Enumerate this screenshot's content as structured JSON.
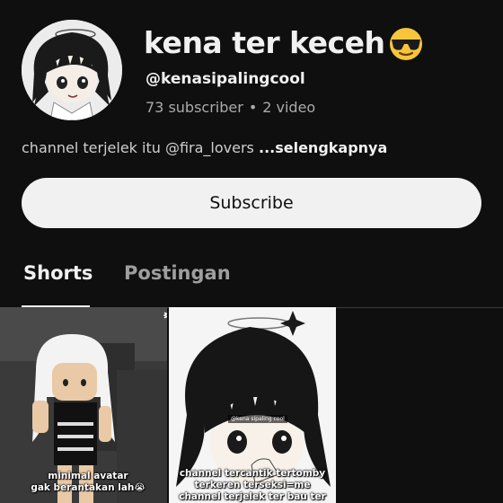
{
  "channel": {
    "name": "kena ter keceh",
    "name_emoji": "sunglasses-emoji",
    "handle": "@kenasipalingcool",
    "subscribers": "73 subscriber",
    "separator": "•",
    "videos": "2 video",
    "description": "channel terjelek itu @fira_lovers",
    "more_label": "...selengkapnya"
  },
  "subscribe_label": "Subscribe",
  "tabs": [
    {
      "label": "Shorts",
      "active": true
    },
    {
      "label": "Postingan",
      "active": false
    }
  ],
  "shorts": [
    {
      "caption_line1": "minimal avatar",
      "caption_line2": "gak berantakan lah😭",
      "overlay_icon": "capcut-icon"
    },
    {
      "caption_line1": "channel tercantik tertomby",
      "caption_line2": "terkeren terseksi=me",
      "caption_line3": "channel terjelek ter bau ter",
      "watermark": "@kena sipaling cool"
    }
  ],
  "colors": {
    "background": "#0f0f0f",
    "text_primary": "#f1f1f1",
    "text_secondary": "#aaaaaa",
    "subscribe_bg": "#f1f1f1"
  }
}
